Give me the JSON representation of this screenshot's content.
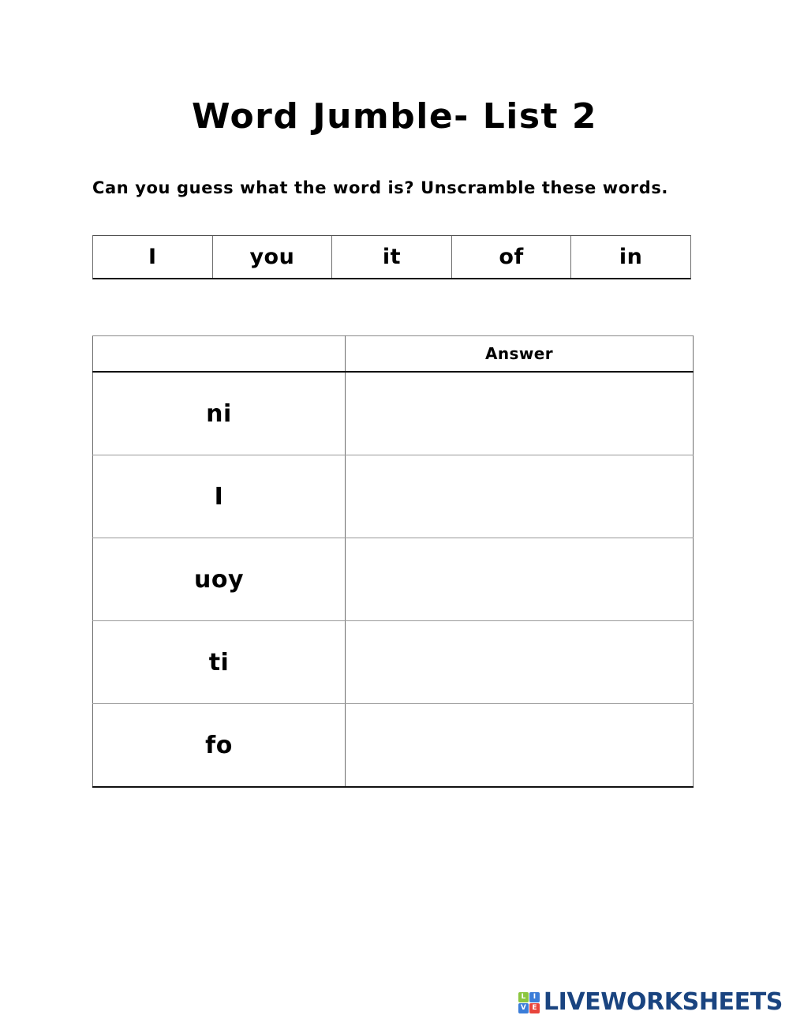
{
  "worksheet": {
    "title": "Word Jumble- List 2",
    "instructions": "Can you guess what the word is? Unscramble these words."
  },
  "word_bank": {
    "words": [
      "I",
      "you",
      "it",
      "of",
      "in"
    ]
  },
  "jumble_table": {
    "headers": [
      "",
      "Answer"
    ],
    "rows": [
      {
        "scrambled": "ni",
        "answer": ""
      },
      {
        "scrambled": "I",
        "answer": ""
      },
      {
        "scrambled": "uoy",
        "answer": ""
      },
      {
        "scrambled": "ti",
        "answer": ""
      },
      {
        "scrambled": "fo",
        "answer": ""
      }
    ]
  },
  "footer": {
    "brand": "LIVEWORKSHEETS",
    "logo_tiles": [
      "L",
      "I",
      "V",
      "E"
    ],
    "colors": {
      "brand_text": "#1a4480",
      "tile_l": "#8cc63f",
      "tile_i": "#3b7dd8",
      "tile_v": "#3b7dd8",
      "tile_e": "#e8453c"
    }
  }
}
